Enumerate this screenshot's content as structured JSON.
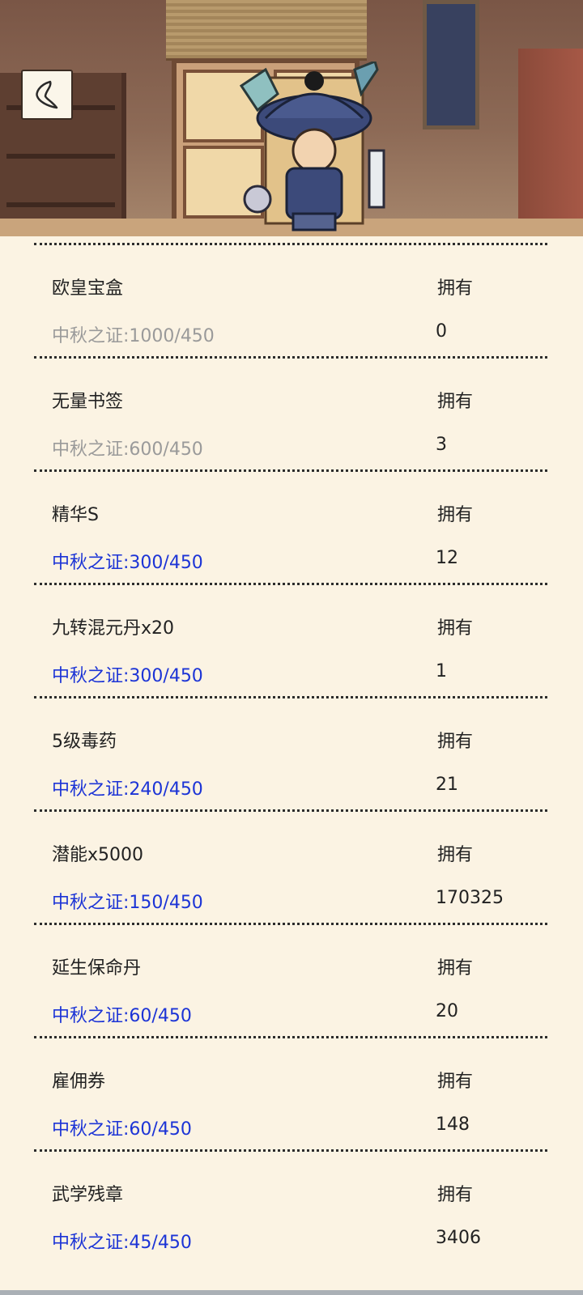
{
  "header": {
    "back_icon": "back-arrow-icon"
  },
  "overlay": {
    "floating_ball_icon": "floating-assistant-icon"
  },
  "colors": {
    "affordable_cost": "#1c34d6",
    "unaffordable_cost": "#9a9a9a",
    "background": "#fbf3e3"
  },
  "items": [
    {
      "name": "欧皇宝盒",
      "own_label": "拥有",
      "cost": "中秋之证:1000/450",
      "owned": "0",
      "affordable": false
    },
    {
      "name": "无量书签",
      "own_label": "拥有",
      "cost": "中秋之证:600/450",
      "owned": "3",
      "affordable": false
    },
    {
      "name": "精华S",
      "own_label": "拥有",
      "cost": "中秋之证:300/450",
      "owned": "12",
      "affordable": true
    },
    {
      "name": "九转混元丹x20",
      "own_label": "拥有",
      "cost": "中秋之证:300/450",
      "owned": "1",
      "affordable": true
    },
    {
      "name": "5级毒药",
      "own_label": "拥有",
      "cost": "中秋之证:240/450",
      "owned": "21",
      "affordable": true
    },
    {
      "name": "潜能x5000",
      "own_label": "拥有",
      "cost": "中秋之证:150/450",
      "owned": "170325",
      "affordable": true
    },
    {
      "name": "延生保命丹",
      "own_label": "拥有",
      "cost": "中秋之证:60/450",
      "owned": "20",
      "affordable": true
    },
    {
      "name": "雇佣券",
      "own_label": "拥有",
      "cost": "中秋之证:60/450",
      "owned": "148",
      "affordable": true
    },
    {
      "name": "武学残章",
      "own_label": "拥有",
      "cost": "中秋之证:45/450",
      "owned": "3406",
      "affordable": true
    }
  ]
}
